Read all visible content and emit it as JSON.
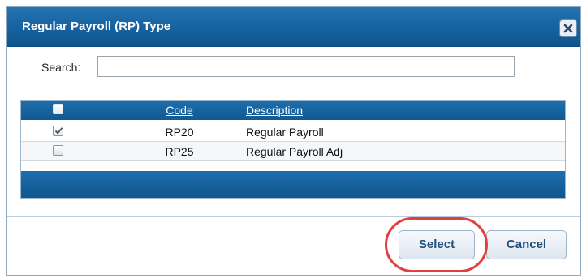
{
  "dialog": {
    "title": "Regular Payroll (RP) Type",
    "close_icon": "close-icon"
  },
  "search": {
    "label": "Search:",
    "value": ""
  },
  "grid": {
    "columns": {
      "code": "Code",
      "description": "Description"
    },
    "rows": [
      {
        "checked": true,
        "code": "RP20",
        "description": "Regular Payroll"
      },
      {
        "checked": false,
        "code": "RP25",
        "description": "Regular Payroll Adj"
      }
    ]
  },
  "buttons": {
    "select": "Select",
    "cancel": "Cancel"
  },
  "colors": {
    "header_blue": "#16619f",
    "highlight_red": "#e0403f",
    "button_text": "#1e4f7a"
  }
}
